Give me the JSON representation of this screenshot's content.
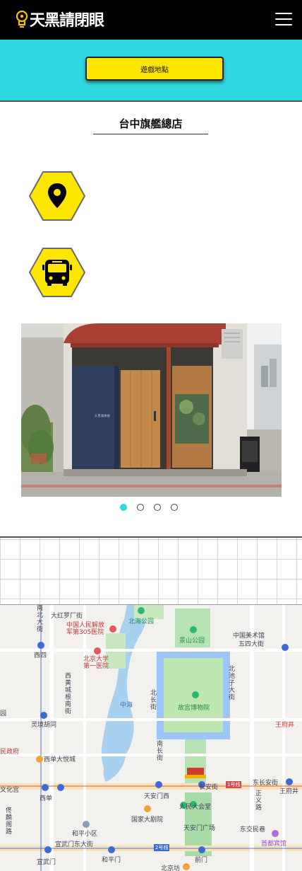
{
  "header": {
    "logo_text": "天黑請閉眼",
    "menu_icon": "hamburger-menu-icon"
  },
  "banner": {
    "button_label": "遊戲地點"
  },
  "store": {
    "title": "台中旗艦總店",
    "location_icon": "map-pin-icon",
    "transport_icon": "bus-icon"
  },
  "carousel": {
    "slide_count": 4,
    "active_index": 0,
    "storefront_sign": "天黑請閉眼"
  },
  "colors": {
    "accent_cyan": "#2fd7df",
    "accent_yellow": "#ffe600",
    "header_black": "#000000"
  },
  "map": {
    "labels": [
      {
        "text": "北海公园"
      },
      {
        "text": "大红罗厂街"
      },
      {
        "text": "景山公园"
      },
      {
        "text": "中国美术馆"
      },
      {
        "text": "五四大街"
      },
      {
        "text": "中国人民解放军第305医院"
      },
      {
        "text": "北京大学第一医院"
      },
      {
        "text": "西四"
      },
      {
        "text": "西黄城根南街"
      },
      {
        "text": "中海"
      },
      {
        "text": "北长街"
      },
      {
        "text": "故宫博物院"
      },
      {
        "text": "北池子大街"
      },
      {
        "text": "灵境胡同"
      },
      {
        "text": "王府井"
      },
      {
        "text": "西单大悦城"
      },
      {
        "text": "南长街"
      },
      {
        "text": "民政府"
      },
      {
        "text": "西单"
      },
      {
        "text": "天安门西"
      },
      {
        "text": "长安街"
      },
      {
        "text": "东长安街"
      },
      {
        "text": "王府井"
      },
      {
        "text": "文化宫"
      },
      {
        "text": "人民大会堂"
      },
      {
        "text": "国家大剧院"
      },
      {
        "text": "天安门广场"
      },
      {
        "text": "和平小区"
      },
      {
        "text": "宣武门东大街"
      },
      {
        "text": "东交民巷"
      },
      {
        "text": "首都宾馆"
      },
      {
        "text": "宣武门"
      },
      {
        "text": "和平门"
      },
      {
        "text": "前门"
      },
      {
        "text": "北京坊"
      },
      {
        "text": "正义路"
      },
      {
        "text": "佟麟阁路"
      },
      {
        "text": "南北大街"
      },
      {
        "text": "1号线"
      },
      {
        "text": "2号线"
      },
      {
        "text": "园"
      }
    ]
  }
}
